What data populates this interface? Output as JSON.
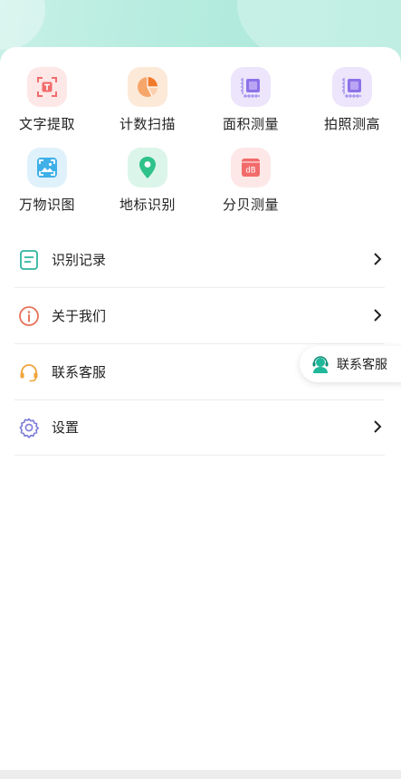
{
  "tools": [
    {
      "label": "文字提取",
      "icon": "text-extract-icon",
      "color": "#f26b6b"
    },
    {
      "label": "计数扫描",
      "icon": "pie-count-icon",
      "color": "#f28a3c"
    },
    {
      "label": "面积测量",
      "icon": "area-chip-icon",
      "color": "#8d72e8"
    },
    {
      "label": "拍照测高",
      "icon": "height-chip-icon",
      "color": "#8d72e8"
    },
    {
      "label": "万物识图",
      "icon": "image-scan-icon",
      "color": "#3fb0e8"
    },
    {
      "label": "地标识别",
      "icon": "location-pin-icon",
      "color": "#2fc28a"
    },
    {
      "label": "分贝测量",
      "icon": "decibel-icon",
      "color": "#f26b6b",
      "badge": "dB"
    }
  ],
  "menu": [
    {
      "label": "识别记录",
      "icon": "record-doc-icon"
    },
    {
      "label": "关于我们",
      "icon": "info-icon"
    },
    {
      "label": "联系客服",
      "icon": "headset-icon"
    },
    {
      "label": "设置",
      "icon": "gear-icon"
    }
  ],
  "floating_service": {
    "label": "联系客服",
    "icon": "agent-icon"
  },
  "colors": {
    "header": "#b6ecdf",
    "accent": "#2fc28a",
    "text": "#222222"
  }
}
